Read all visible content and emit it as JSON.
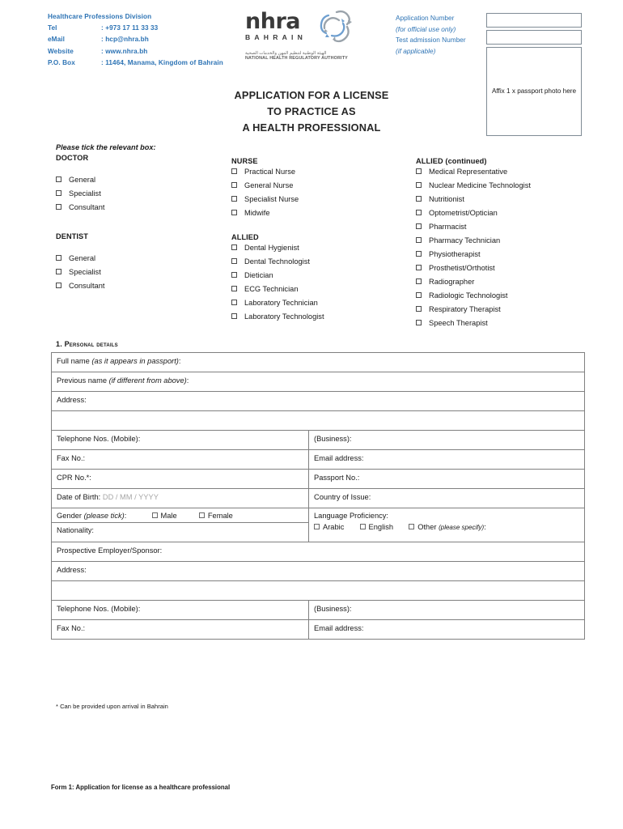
{
  "header": {
    "division": "Healthcare Professions Division",
    "contacts": [
      {
        "label": "Tel",
        "value": ": +973 17 11 33 33"
      },
      {
        "label": "eMail",
        "value": ": hcp@nhra.bh"
      },
      {
        "label": "Website",
        "value": ": www.nhra.bh"
      },
      {
        "label": "P.O. Box",
        "value": ": 11464, Manama, Kingdom of Bahrain"
      }
    ],
    "brand_color": "#2E74B5",
    "logo": {
      "wordmark": "nhra",
      "country": "BAHRAIN",
      "arabic": "الهيئة الوطنية لتنظيم المهن والخدمات الصحية",
      "subtitle": "NATIONAL HEALTH REGULATORY AUTHORITY"
    },
    "official_use": {
      "application_number": "Application Number",
      "official_only": "(for official use only)",
      "test_admission": "Test admission Number",
      "if_applicable": "(if applicable)"
    },
    "photo_box": "Affix 1 x passport photo here"
  },
  "title": {
    "line1": "APPLICATION FOR A LICENSE",
    "line2": "TO PRACTICE AS",
    "line3": "A HEALTH PROFESSIONAL"
  },
  "tick_section": {
    "intro": "Please tick the relevant box:",
    "groups": {
      "doctor": {
        "heading": "DOCTOR",
        "items": [
          "General",
          "Specialist",
          "Consultant"
        ]
      },
      "dentist": {
        "heading": "DENTIST",
        "items": [
          "General",
          "Specialist",
          "Consultant"
        ]
      },
      "nurse": {
        "heading": "NURSE",
        "items": [
          "Practical Nurse",
          "General Nurse",
          "Specialist Nurse",
          "Midwife"
        ]
      },
      "allied": {
        "heading": "ALLIED",
        "items": [
          "Dental Hygienist",
          "Dental Technologist",
          "Dietician",
          "ECG Technician",
          "Laboratory Technician",
          "Laboratory Technologist"
        ]
      },
      "allied_continued": {
        "heading": "ALLIED (continued)",
        "items": [
          "Medical Representative",
          "Nuclear Medicine Technologist",
          "Nutritionist",
          "Optometrist/Optician",
          "Pharmacist",
          "Pharmacy Technician",
          "Physiotherapist",
          "Prosthetist/Orthotist",
          "Radiographer",
          "Radiologic Technologist",
          "Respiratory Therapist",
          "Speech Therapist"
        ]
      }
    }
  },
  "personal_details": {
    "section_number": "1.",
    "section_title": "Personal details",
    "full_name_label": "Full name",
    "full_name_hint": "(as it appears in passport)",
    "previous_name_label": "Previous name",
    "previous_name_hint": "(if different from above)",
    "address_label": "Address:",
    "telephone_mobile_label": "Telephone Nos.  (Mobile):",
    "business_label": "(Business):",
    "fax_label": "Fax No.:",
    "email_label": "Email address:",
    "cpr_label": "CPR No.*:",
    "passport_label": "Passport No.:",
    "dob_label": "Date of Birth:",
    "dob_placeholder": "DD / MM / YYYY",
    "country_of_issue_label": "Country of Issue:",
    "gender_label": "Gender",
    "gender_hint": "(please tick)",
    "gender_male": "Male",
    "gender_female": "Female",
    "nationality_label": "Nationality:",
    "language_label": "Language Proficiency:",
    "lang_arabic": "Arabic",
    "lang_english": "English",
    "lang_other": "Other",
    "lang_other_hint": "(please specify)",
    "employer_label": "Prospective Employer/Sponsor:",
    "employer_address_label": "Address:",
    "telephone_mobile_label2": "Telephone Nos. (Mobile):",
    "business_label2": "(Business):",
    "fax_label2": "Fax No.:",
    "email_label2": "Email address:"
  },
  "footnote": "* Can be provided upon arrival in Bahrain",
  "page_footer": "Form 1: Application for license as a healthcare professional"
}
